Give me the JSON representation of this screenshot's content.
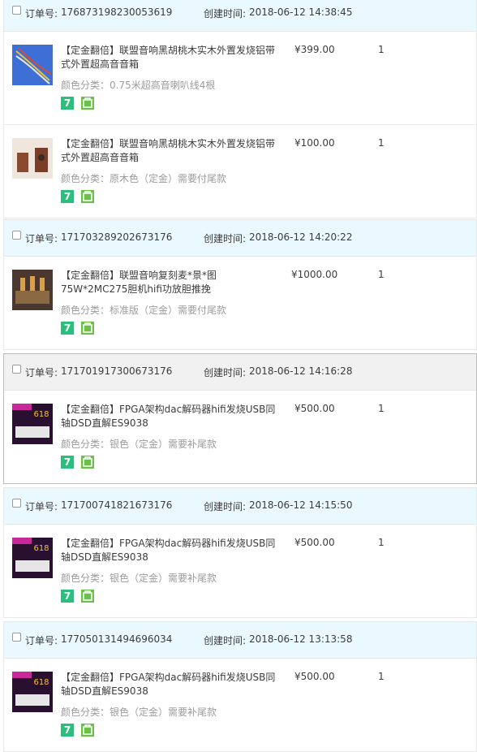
{
  "labels": {
    "order_no": "订单号:",
    "created": "创建时间:"
  },
  "badge_seven_text": "7",
  "colors": {
    "header_bg": "#eaf8ff",
    "seven_badge": "#2bbf7e",
    "shop_badge": "#6cc04a"
  },
  "orders": [
    {
      "order_no": "176873198230053619",
      "created_time": "2018-06-12 14:38:45",
      "items": [
        {
          "title": "【定金翻倍】联盟音响黑胡桃木实木外置发烧铝带式外置超高音音箱",
          "sku": "颜色分类：0.75米超高音喇叭线4根",
          "price": "¥399.00",
          "qty": "1",
          "thumb": "cable-image"
        },
        {
          "title": "【定金翻倍】联盟音响黑胡桃木实木外置发烧铝带式外置超高音音箱",
          "sku": "颜色分类：原木色（定金）需要付尾款",
          "price": "¥100.00",
          "qty": "1",
          "thumb": "speaker-image"
        }
      ]
    },
    {
      "order_no": "171703289202673176",
      "created_time": "2018-06-12 14:20:22",
      "items": [
        {
          "title": "【定金翻倍】联盟音响复刻麦*景*图75W*2MC275胆机hifi功放胆推挽",
          "sku": "颜色分类：标准版（定金）需要付尾款",
          "price": "¥1000.00",
          "qty": "1",
          "thumb": "amplifier-image"
        }
      ]
    },
    {
      "order_no": "171701917300673176",
      "created_time": "2018-06-12 14:16:28",
      "items": [
        {
          "title": "【定金翻倍】FPGA架构dac解码器hifi发烧USB同轴DSD直解ES9038",
          "sku": "颜色分类：银色（定金）需要补尾款",
          "price": "¥500.00",
          "qty": "1",
          "thumb": "dac-image"
        }
      ]
    },
    {
      "order_no": "171700741821673176",
      "created_time": "2018-06-12 14:15:50",
      "items": [
        {
          "title": "【定金翻倍】FPGA架构dac解码器hifi发烧USB同轴DSD直解ES9038",
          "sku": "颜色分类：银色（定金）需要补尾款",
          "price": "¥500.00",
          "qty": "1",
          "thumb": "dac-image"
        }
      ]
    },
    {
      "order_no": "177050131494696034",
      "created_time": "2018-06-12 13:13:58",
      "items": [
        {
          "title": "【定金翻倍】FPGA架构dac解码器hifi发烧USB同轴DSD直解ES9038",
          "sku": "颜色分类：银色（定金）需要补尾款",
          "price": "¥500.00",
          "qty": "1",
          "thumb": "dac-image"
        }
      ]
    }
  ]
}
